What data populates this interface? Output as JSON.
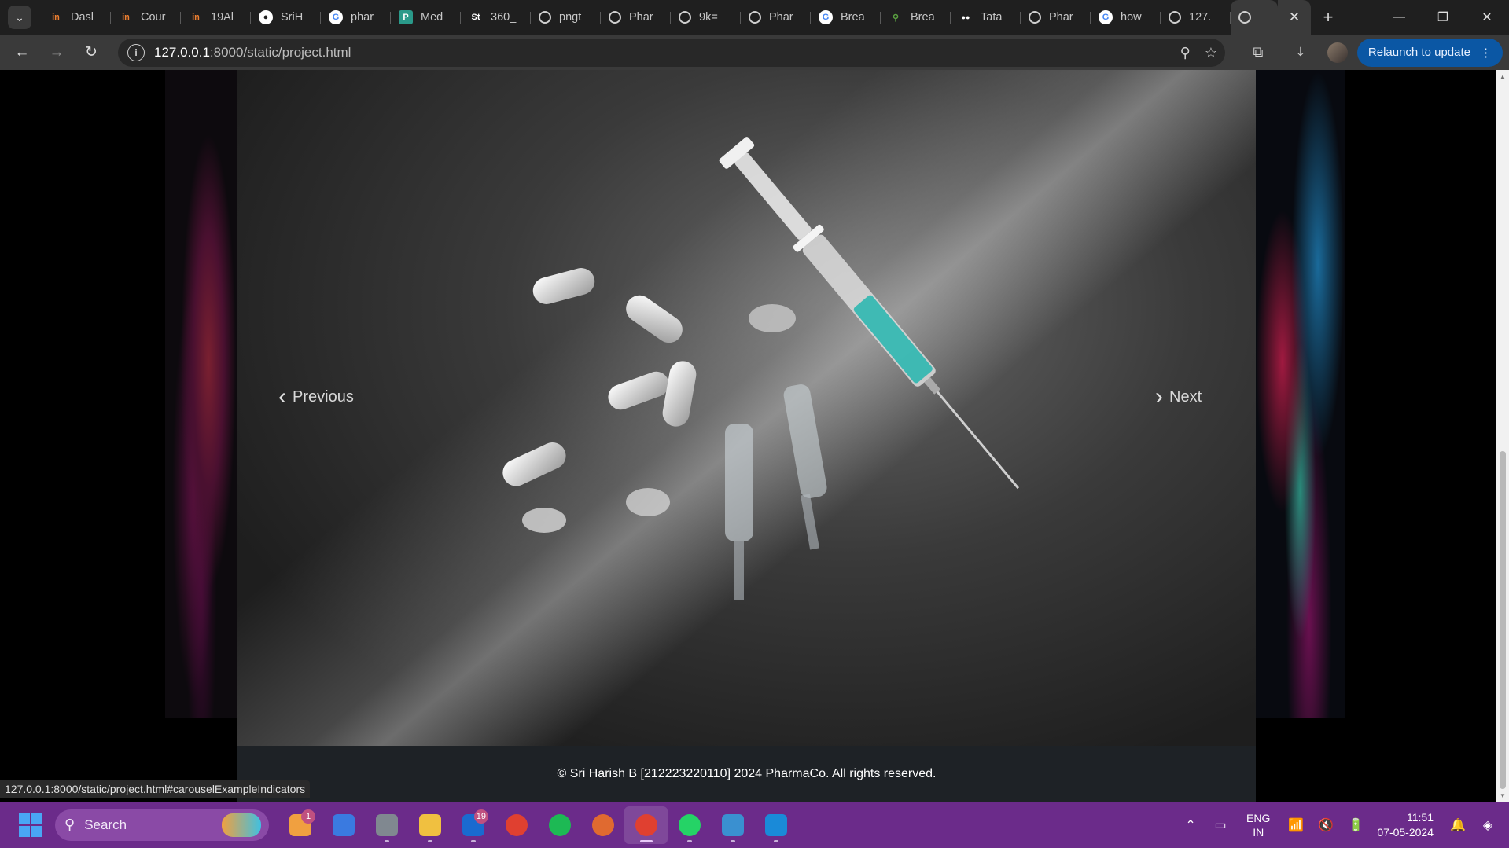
{
  "browser": {
    "tabs": [
      {
        "label": "Dasl",
        "icon": "in",
        "color": "#f08030"
      },
      {
        "label": "Cour",
        "icon": "in",
        "color": "#f08030"
      },
      {
        "label": "19Al",
        "icon": "in",
        "color": "#f08030"
      },
      {
        "label": "SriH",
        "icon": "github",
        "color": "#ffffff"
      },
      {
        "label": "phar",
        "icon": "G",
        "color": "#ffffff"
      },
      {
        "label": "Med",
        "icon": "P",
        "color": "#2a9a8a"
      },
      {
        "label": "360_",
        "icon": "St",
        "color": "#ffffff"
      },
      {
        "label": "pngt",
        "icon": "globe",
        "color": "#cfcfcf"
      },
      {
        "label": "Phar",
        "icon": "globe",
        "color": "#cfcfcf"
      },
      {
        "label": "9k=",
        "icon": "globe",
        "color": "#cfcfcf"
      },
      {
        "label": "Phar",
        "icon": "globe",
        "color": "#cfcfcf"
      },
      {
        "label": "Brea",
        "icon": "G",
        "color": "#ffffff"
      },
      {
        "label": "Brea",
        "icon": "leaf",
        "color": "#5aa040"
      },
      {
        "label": "Tata",
        "icon": "medium",
        "color": "#ffffff"
      },
      {
        "label": "Phar",
        "icon": "globe",
        "color": "#cfcfcf"
      },
      {
        "label": "how",
        "icon": "G",
        "color": "#ffffff"
      },
      {
        "label": "127.",
        "icon": "globe",
        "color": "#cfcfcf"
      }
    ],
    "active_tab": {
      "label": "",
      "icon": "globe"
    },
    "new_tab": "+",
    "url_host": "127.0.0.1",
    "url_path": ":8000/static/project.html",
    "relaunch_label": "Relaunch to update",
    "status_url": "127.0.0.1:8000/static/project.html#carouselExampleIndicators"
  },
  "carousel": {
    "prev_label": "Previous",
    "next_label": "Next"
  },
  "footer": {
    "text": "© Sri Harish B [212223220110] 2024 PharmaCo. All rights reserved."
  },
  "taskbar": {
    "search_label": "Search",
    "apps": [
      {
        "name": "weather",
        "badge": "1",
        "color": "#f0a040"
      },
      {
        "name": "store",
        "badge": "",
        "color": "#3a7ae0"
      },
      {
        "name": "settings",
        "badge": "",
        "color": "#808890"
      },
      {
        "name": "file-explorer",
        "badge": "",
        "color": "#f0c040"
      },
      {
        "name": "mail",
        "badge": "19",
        "color": "#1a6ad0"
      },
      {
        "name": "chrome",
        "badge": "",
        "color": "#e04030"
      },
      {
        "name": "spotify",
        "badge": "",
        "color": "#1db954"
      },
      {
        "name": "firefox",
        "badge": "",
        "color": "#e06a30"
      },
      {
        "name": "chrome-active",
        "badge": "",
        "color": "#e04030"
      },
      {
        "name": "whatsapp",
        "badge": "",
        "color": "#25d366"
      },
      {
        "name": "notepad",
        "badge": "",
        "color": "#3a90d0"
      },
      {
        "name": "vscode",
        "badge": "",
        "color": "#1a8ad8"
      }
    ],
    "lang_top": "ENG",
    "lang_bottom": "IN",
    "time": "11:51",
    "date": "07-05-2024"
  }
}
